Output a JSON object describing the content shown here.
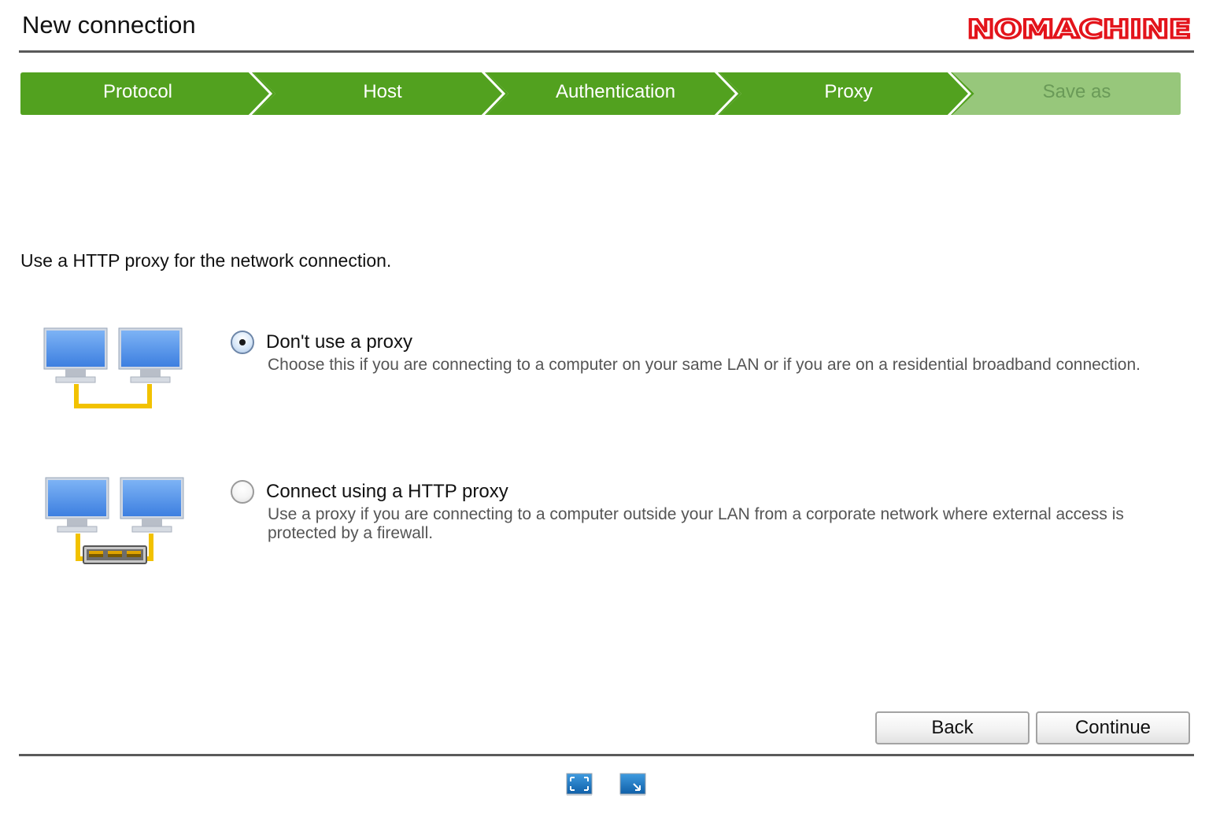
{
  "window": {
    "title": "New connection",
    "brand": "NOMACHINE",
    "brand_color": "#e3141b"
  },
  "steps": [
    {
      "label": "Protocol",
      "state": "done"
    },
    {
      "label": "Host",
      "state": "done"
    },
    {
      "label": "Authentication",
      "state": "done"
    },
    {
      "label": "Proxy",
      "state": "current"
    },
    {
      "label": "Save as",
      "state": "pending"
    }
  ],
  "colors": {
    "step_active": "#52a11f",
    "step_pending": "#97c77b",
    "monitor_blue": "#4a8fe9",
    "cable_yellow": "#f2c200"
  },
  "main": {
    "intro": "Use a HTTP proxy for the network connection.",
    "options": [
      {
        "title": "Don't use a proxy",
        "description": "Choose this if you are connecting to a computer on your same LAN or if you are on a residential broadband connection.",
        "selected": true,
        "illustration": "direct-lan-icon"
      },
      {
        "title": "Connect using a HTTP proxy",
        "description": "Use a proxy if you are connecting to a computer outside your LAN from a corporate network where external access is protected by a firewall.",
        "selected": false,
        "illustration": "proxy-network-icon"
      }
    ]
  },
  "buttons": {
    "back": "Back",
    "continue": "Continue"
  },
  "footer": {
    "icons": [
      "fullscreen-icon",
      "resize-window-icon"
    ]
  }
}
